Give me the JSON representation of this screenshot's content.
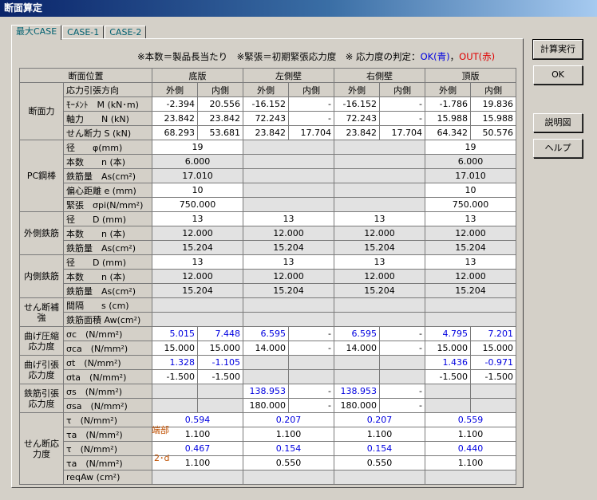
{
  "window": {
    "title": "断面算定"
  },
  "tabs": [
    "最大CASE",
    "CASE-1",
    "CASE-2"
  ],
  "legend": {
    "part1": "※本数＝製品長当たり　※緊張＝初期緊張応力度　※ 応力度の判定：",
    "ok": "OK(青)",
    "comma": "，",
    "out": "OUT(赤)"
  },
  "buttons": {
    "calc": "計算実行",
    "ok": "OK",
    "explain": "説明図",
    "help": "ヘルプ"
  },
  "header": {
    "position": "断面位置",
    "stress_dir": "応力引張方向",
    "bottom": "底版",
    "left": "左側壁",
    "right": "右側壁",
    "top": "頂版",
    "outer": "外側",
    "inner": "内側"
  },
  "sections": {
    "force": "断面力",
    "pc": "PC鋼棒",
    "outer_rebar": "外側鉄筋",
    "inner_rebar": "内側鉄筋",
    "shear_reinf": "せん断補強",
    "bend_comp": "曲げ圧縮応力度",
    "bend_tens": "曲げ引張応力度",
    "rebar_tens": "鉄筋引張応力度",
    "shear": "せん断応力度"
  },
  "markers": {
    "end": "端部",
    "twod": "2･d"
  },
  "rows": {
    "moment": {
      "label": "ﾓｰﾒﾝﾄ　M (kN･m)",
      "v": [
        "-2.394",
        "20.556",
        "-16.152",
        "-",
        "-16.152",
        "-",
        "-1.786",
        "19.836"
      ]
    },
    "axial": {
      "label": "軸力　　N (kN)",
      "v": [
        "23.842",
        "23.842",
        "72.243",
        "-",
        "72.243",
        "-",
        "15.988",
        "15.988"
      ]
    },
    "shearforce": {
      "label": "せん断力 S (kN)",
      "v": [
        "68.293",
        "53.681",
        "23.842",
        "17.704",
        "23.842",
        "17.704",
        "64.342",
        "50.576"
      ]
    },
    "pc_dia": {
      "label": "径　　φ(mm)",
      "v": [
        "19",
        "",
        "",
        "19"
      ]
    },
    "pc_n": {
      "label": "本数　　n (本)",
      "v": [
        "6.000",
        "",
        "",
        "6.000"
      ]
    },
    "pc_as": {
      "label": "鉄筋量　As(cm²)",
      "v": [
        "17.010",
        "",
        "",
        "17.010"
      ]
    },
    "pc_e": {
      "label": "偏心距離 e (mm)",
      "v": [
        "10",
        "",
        "",
        "10"
      ]
    },
    "pc_sp": {
      "label": "緊張　σpi(N/mm²)",
      "v": [
        "750.000",
        "",
        "",
        "750.000"
      ]
    },
    "or_d": {
      "label": "径　　D (mm)",
      "v": [
        "13",
        "13",
        "13",
        "13"
      ]
    },
    "or_n": {
      "label": "本数　　n (本)",
      "v": [
        "12.000",
        "12.000",
        "12.000",
        "12.000"
      ]
    },
    "or_as": {
      "label": "鉄筋量　As(cm²)",
      "v": [
        "15.204",
        "15.204",
        "15.204",
        "15.204"
      ]
    },
    "ir_d": {
      "label": "径　　D (mm)",
      "v": [
        "13",
        "13",
        "13",
        "13"
      ]
    },
    "ir_n": {
      "label": "本数　　n (本)",
      "v": [
        "12.000",
        "12.000",
        "12.000",
        "12.000"
      ]
    },
    "ir_as": {
      "label": "鉄筋量　As(cm²)",
      "v": [
        "15.204",
        "15.204",
        "15.204",
        "15.204"
      ]
    },
    "sr_s": {
      "label": "間隔　　s (cm)",
      "v": [
        "",
        "",
        "",
        ""
      ]
    },
    "sr_aw": {
      "label": "鉄筋面積 Aw(cm²)",
      "v": [
        "",
        "",
        "",
        ""
      ]
    },
    "sc": {
      "label": "σc　(N/mm²)",
      "v": [
        "5.015",
        "7.448",
        "6.595",
        "-",
        "6.595",
        "-",
        "4.795",
        "7.201"
      ]
    },
    "sca": {
      "label": "σca　(N/mm²)",
      "v": [
        "15.000",
        "15.000",
        "14.000",
        "-",
        "14.000",
        "-",
        "15.000",
        "15.000"
      ]
    },
    "st": {
      "label": "σt　(N/mm²)",
      "v": [
        "1.328",
        "-1.105",
        "",
        "",
        "",
        "",
        "1.436",
        "-0.971"
      ]
    },
    "sta": {
      "label": "σta　(N/mm²)",
      "v": [
        "-1.500",
        "-1.500",
        "",
        "",
        "",
        "",
        "-1.500",
        "-1.500"
      ]
    },
    "ss": {
      "label": "σs　(N/mm²)",
      "v": [
        "",
        "",
        "138.953",
        "-",
        "138.953",
        "-",
        "",
        ""
      ]
    },
    "ssa": {
      "label": "σsa　(N/mm²)",
      "v": [
        "",
        "",
        "180.000",
        "-",
        "180.000",
        "-",
        "",
        ""
      ]
    },
    "tau1": {
      "label": "τ　(N/mm²)",
      "v": [
        "0.594",
        "0.207",
        "0.207",
        "0.559"
      ]
    },
    "taua1": {
      "label": "τa　(N/mm²)",
      "v": [
        "1.100",
        "1.100",
        "1.100",
        "1.100"
      ]
    },
    "tau2": {
      "label": "τ　(N/mm²)",
      "v": [
        "0.467",
        "0.154",
        "0.154",
        "0.440"
      ]
    },
    "taua2": {
      "label": "τa　(N/mm²)",
      "v": [
        "1.100",
        "0.550",
        "0.550",
        "1.100"
      ]
    },
    "reqaw": {
      "label": "reqAw (cm²)",
      "v": [
        "",
        "",
        "",
        ""
      ]
    }
  }
}
